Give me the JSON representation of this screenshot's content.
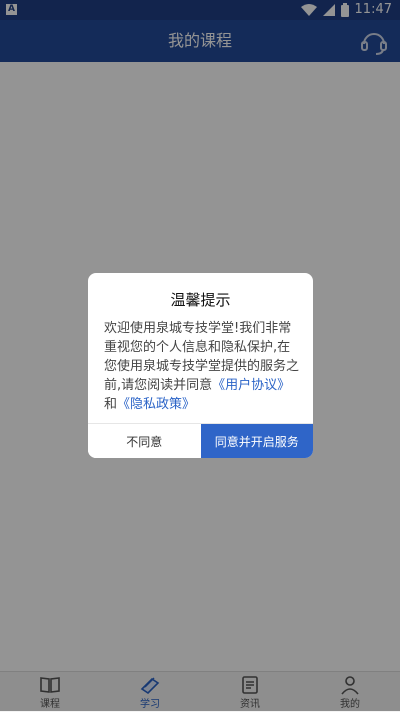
{
  "status_bar": {
    "app_badge": "A",
    "time": "11:47",
    "icons": [
      "wifi-icon",
      "signal-icon",
      "battery-icon"
    ]
  },
  "header": {
    "title": "我的课程",
    "support_icon": "headset-icon"
  },
  "dialog": {
    "title": "温馨提示",
    "body_prefix": "欢迎使用泉城专技学堂!我们非常重视您的个人信息和隐私保护,在您使用泉城专技学堂提供的服务之前,请您阅读并同意",
    "link_user_agreement": "《用户协议》",
    "body_and": "和",
    "link_privacy_policy": "《隐私政策》",
    "decline_label": "不同意",
    "accept_label": "同意并开启服务"
  },
  "tabs": [
    {
      "label": "课程",
      "icon": "book-open-icon",
      "active": false
    },
    {
      "label": "学习",
      "icon": "books-icon",
      "active": true
    },
    {
      "label": "资讯",
      "icon": "news-icon",
      "active": false
    },
    {
      "label": "我的",
      "icon": "person-icon",
      "active": false
    }
  ],
  "colors": {
    "header": "#244a99",
    "accent": "#2f65c8",
    "link": "#2a63c7"
  }
}
